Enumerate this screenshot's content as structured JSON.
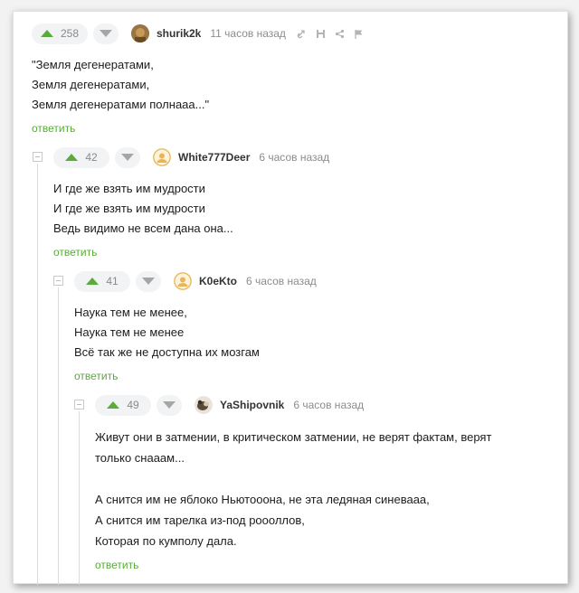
{
  "comments": [
    {
      "score": "258",
      "username": "shurik2k",
      "time": "11 часов назад",
      "lines": [
        "\"Земля дегенератами,",
        "Земля дегенератами,",
        "Земля дегенератами полнааа...\""
      ],
      "reply": "ответить",
      "avatar_icon": "avatar-tan"
    },
    {
      "score": "42",
      "username": "White777Deer",
      "time": "6 часов назад",
      "lines": [
        "И где же взять им мудрости",
        "И где же взять им мудрости",
        "Ведь видимо не всем дана она..."
      ],
      "reply": "ответить",
      "avatar_icon": "avatar-placeholder"
    },
    {
      "score": "41",
      "username": "K0eKto",
      "time": "6 часов назад",
      "lines": [
        "Наука тем не менее,",
        "Наука тем не менее",
        "Всё так же не доступна их мозгам"
      ],
      "reply": "ответить",
      "avatar_icon": "avatar-placeholder"
    },
    {
      "score": "49",
      "username": "YaShipovnik",
      "time": "6 часов назад",
      "lines": [
        "Живут они в затмении, в критическом затмении, не верят фактам, верят",
        "только снааам...",
        "",
        "А снится им не яблоко Ньютооона, не эта ледяная синеваaa,",
        "А снится им тарелка из-под роооллов,",
        "Которая по кумполу дала."
      ],
      "reply": "ответить",
      "avatar_icon": "avatar-dog"
    }
  ],
  "colors": {
    "accent_green": "#5aaa3c",
    "pill_bg": "#f1f3f4",
    "muted_text": "#8c8c8c"
  }
}
